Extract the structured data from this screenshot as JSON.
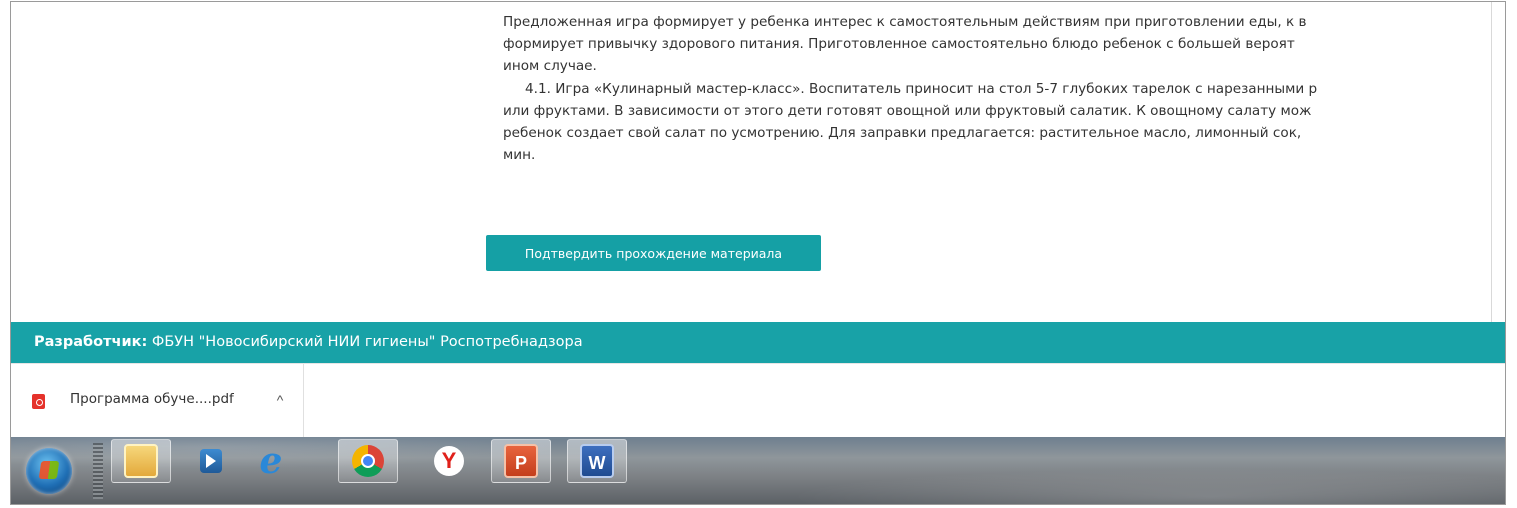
{
  "content": {
    "paragraph_lines": [
      "Предложенная игра формирует у ребенка интерес к самостоятельным действиям при приготовлении еды, к в",
      "формирует привычку здорового питания. Приготовленное самостоятельно блюдо ребенок с большей вероят",
      "ином случае.",
      "4.1. Игра «Кулинарный мастер-класс». Воспитатель приносит на стол 5-7 глубоких тарелок с нарезанными р",
      "или фруктами. В зависимости от этого дети готовят овощной или фруктовый салатик. К овощному салату мож",
      "ребенок создает свой салат по усмотрению. Для заправки предлагается: растительное масло, лимонный сок,",
      "мин."
    ],
    "confirm_button_label": "Подтвердить прохождение материала"
  },
  "footer": {
    "developer_label": "Разработчик:",
    "developer_name": "ФБУН \"Новосибирский НИИ гигиены\" Роспотребнадзора"
  },
  "downloads": {
    "item_name": "Программа обуче....pdf",
    "item_icon": "pdf-file-icon",
    "expand_icon": "chevron-up-icon",
    "expand_glyph": "^"
  },
  "taskbar": {
    "icons": [
      "windows-start-icon",
      "file-explorer-icon",
      "media-player-icon",
      "internet-explorer-icon",
      "chrome-icon",
      "yandex-browser-icon",
      "powerpoint-icon",
      "word-icon"
    ],
    "glyphs": {
      "ie": "e",
      "yandex": "Y",
      "ppt": "P",
      "word": "W"
    },
    "accent": "#18a2a7"
  }
}
